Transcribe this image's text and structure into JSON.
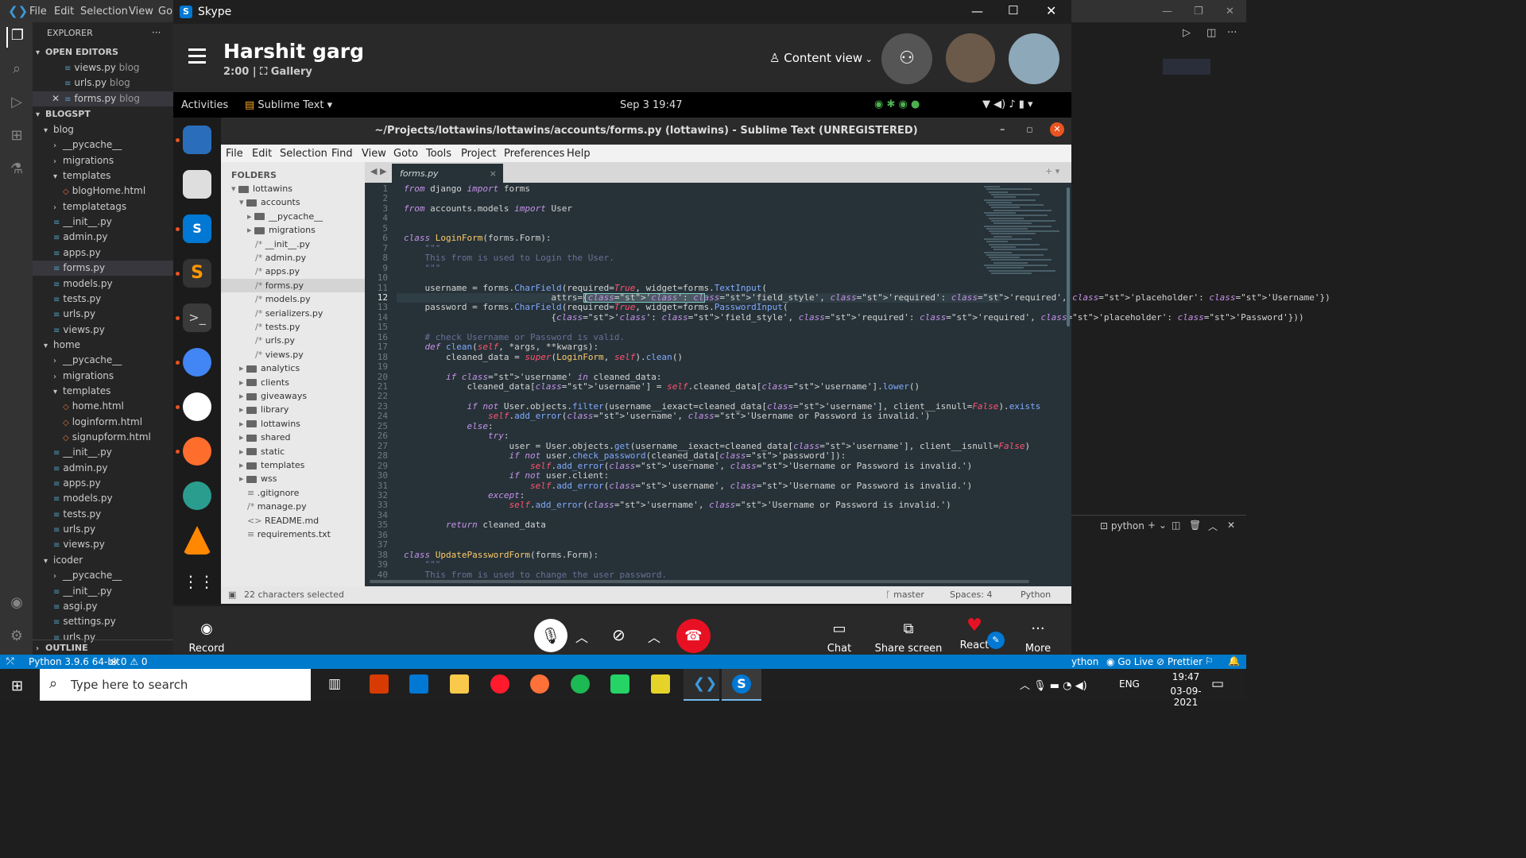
{
  "vscode": {
    "menu": [
      "File",
      "Edit",
      "Selection",
      "View",
      "Go"
    ],
    "explorer_title": "EXPLORER",
    "open_editors": {
      "title": "OPEN EDITORS",
      "items": [
        {
          "name": "views.py",
          "dir": "blog"
        },
        {
          "name": "urls.py",
          "dir": "blog"
        },
        {
          "name": "forms.py",
          "dir": "blog"
        }
      ]
    },
    "project": "BLOGSPT",
    "tree": [
      "blog",
      "__pycache__",
      "migrations",
      "templates",
      "blogHome.html",
      "templatetags",
      "__init__.py",
      "admin.py",
      "apps.py",
      "forms.py",
      "models.py",
      "tests.py",
      "urls.py",
      "views.py",
      "home",
      "__pycache__",
      "migrations",
      "templates",
      "home.html",
      "loginform.html",
      "signupform.html",
      "__init__.py",
      "admin.py",
      "apps.py",
      "models.py",
      "tests.py",
      "urls.py",
      "views.py",
      "icoder",
      "__pycache__",
      "__init__.py",
      "asgi.py",
      "settings.py",
      "urls.py"
    ],
    "outline": "OUTLINE",
    "terminal_label": "python",
    "status": {
      "python": "Python 3.9.6 64-bit",
      "errors": "⊗ 0 ⚠ 0",
      "golive": "Go Live",
      "prettier": "Prettier",
      "lang": "ython"
    }
  },
  "skype": {
    "app": "Skype",
    "caller": "Harshit garg",
    "duration": "2:00",
    "view": "Gallery",
    "content_view": "Content view",
    "controls": {
      "record": "Record",
      "chat": "Chat",
      "share": "Share screen",
      "react": "React",
      "more": "More"
    }
  },
  "ubuntu": {
    "activities": "Activities",
    "app": "Sublime Text",
    "clock": "Sep 3  19:47"
  },
  "sublime": {
    "title": "~/Projects/lottawins/lottawins/accounts/forms.py (lottawins) - Sublime Text (UNREGISTERED)",
    "menu": [
      "File",
      "Edit",
      "Selection",
      "Find",
      "View",
      "Goto",
      "Tools",
      "Project",
      "Preferences",
      "Help"
    ],
    "folders_title": "FOLDERS",
    "folders": [
      "lottawins",
      "accounts",
      "__pycache__",
      "migrations",
      "__init__.py",
      "admin.py",
      "apps.py",
      "forms.py",
      "models.py",
      "serializers.py",
      "tests.py",
      "urls.py",
      "views.py",
      "analytics",
      "clients",
      "giveaways",
      "library",
      "lottawins",
      "shared",
      "static",
      "templates",
      "wss",
      ".gitignore",
      "manage.py",
      "README.md",
      "requirements.txt"
    ],
    "tab": "forms.py",
    "status_left": "22 characters selected",
    "branch": "master",
    "spaces": "Spaces: 4",
    "syntax": "Python",
    "code": [
      "from django import forms",
      "",
      "from accounts.models import User",
      "",
      "",
      "class LoginForm(forms.Form):",
      "    \"\"\"",
      "    This from is used to Login the User.",
      "    \"\"\"",
      "",
      "    username = forms.CharField(required=True, widget=forms.TextInput(",
      "                            attrs={'class': 'field_style', 'required': 'required', 'placeholder': 'Username'})",
      "    password = forms.CharField(required=True, widget=forms.PasswordInput(",
      "                            {'class': 'field_style', 'required': 'required', 'placeholder': 'Password'}))",
      "",
      "    # check Username or Password is valid.",
      "    def clean(self, *args, **kwargs):",
      "        cleaned_data = super(LoginForm, self).clean()",
      "",
      "        if 'username' in cleaned_data:",
      "            cleaned_data['username'] = self.cleaned_data['username'].lower()",
      "",
      "            if not User.objects.filter(username__iexact=cleaned_data['username'], client__isnull=False).exists",
      "                self.add_error('username', 'Username or Password is invalid.')",
      "            else:",
      "                try:",
      "                    user = User.objects.get(username__iexact=cleaned_data['username'], client__isnull=False)",
      "                    if not user.check_password(cleaned_data['password']):",
      "                        self.add_error('username', 'Username or Password is invalid.')",
      "                    if not user.client:",
      "                        self.add_error('username', 'Username or Password is invalid.')",
      "                except:",
      "                    self.add_error('username', 'Username or Password is invalid.')",
      "",
      "        return cleaned_data",
      "",
      "",
      "class UpdatePasswordForm(forms.Form):",
      "    \"\"\"",
      "    This from is used to change the user password."
    ]
  },
  "taskbar": {
    "search_placeholder": "Type here to search",
    "time": "19:47",
    "date": "03-09-2021",
    "lang": "ENG"
  },
  "colors": {
    "vscode_blue": "#007acc",
    "skype_blue": "#0078d4",
    "end_call": "#e81123",
    "sublime_bg": "#263238",
    "ubuntu_orange": "#e95420"
  }
}
